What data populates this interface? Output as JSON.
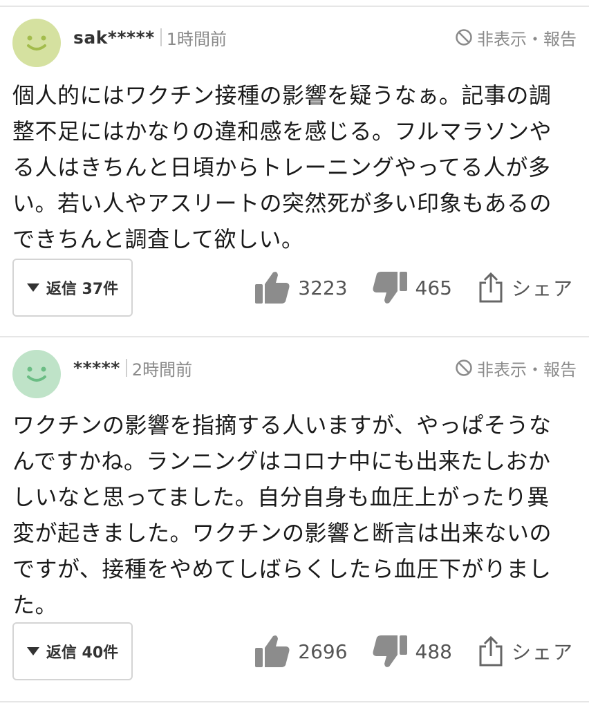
{
  "comments": [
    {
      "avatar_color": "#d5e1a0",
      "avatar_face_color": "#a3bc4c",
      "username": "sak*****",
      "time": "1時間前",
      "hide_report": "非表示・報告",
      "text": "個人的にはワクチン接種の影響を疑うなぁ。記事の調\n整不足にはかなりの違和感を感じる。フルマラソンや\nる人はきちんと日頃からトレーニングやってる人が多\nい。若い人やアスリートの突然死が多い印象もあるの\nできちんと調査して欲しい。",
      "replies_label": "返信 37件",
      "likes": "3223",
      "dislikes": "465",
      "share_label": "シェア"
    },
    {
      "avatar_color": "#bfe3c8",
      "avatar_face_color": "#6bbd84",
      "username": "*****",
      "time": "2時間前",
      "hide_report": "非表示・報告",
      "text": "ワクチンの影響を指摘する人いますが、やっぱそうな\nんですかね。ランニングはコロナ中にも出来たしおか\nしいなと思ってました。自分自身も血圧上がったり異\n変が起きました。ワクチンの影響と断言は出来ないの\nですが、接種をやめてしばらくしたら血圧下がりまし\nた。",
      "replies_label": "返信 40件",
      "likes": "2696",
      "dislikes": "488",
      "share_label": "シェア"
    }
  ]
}
